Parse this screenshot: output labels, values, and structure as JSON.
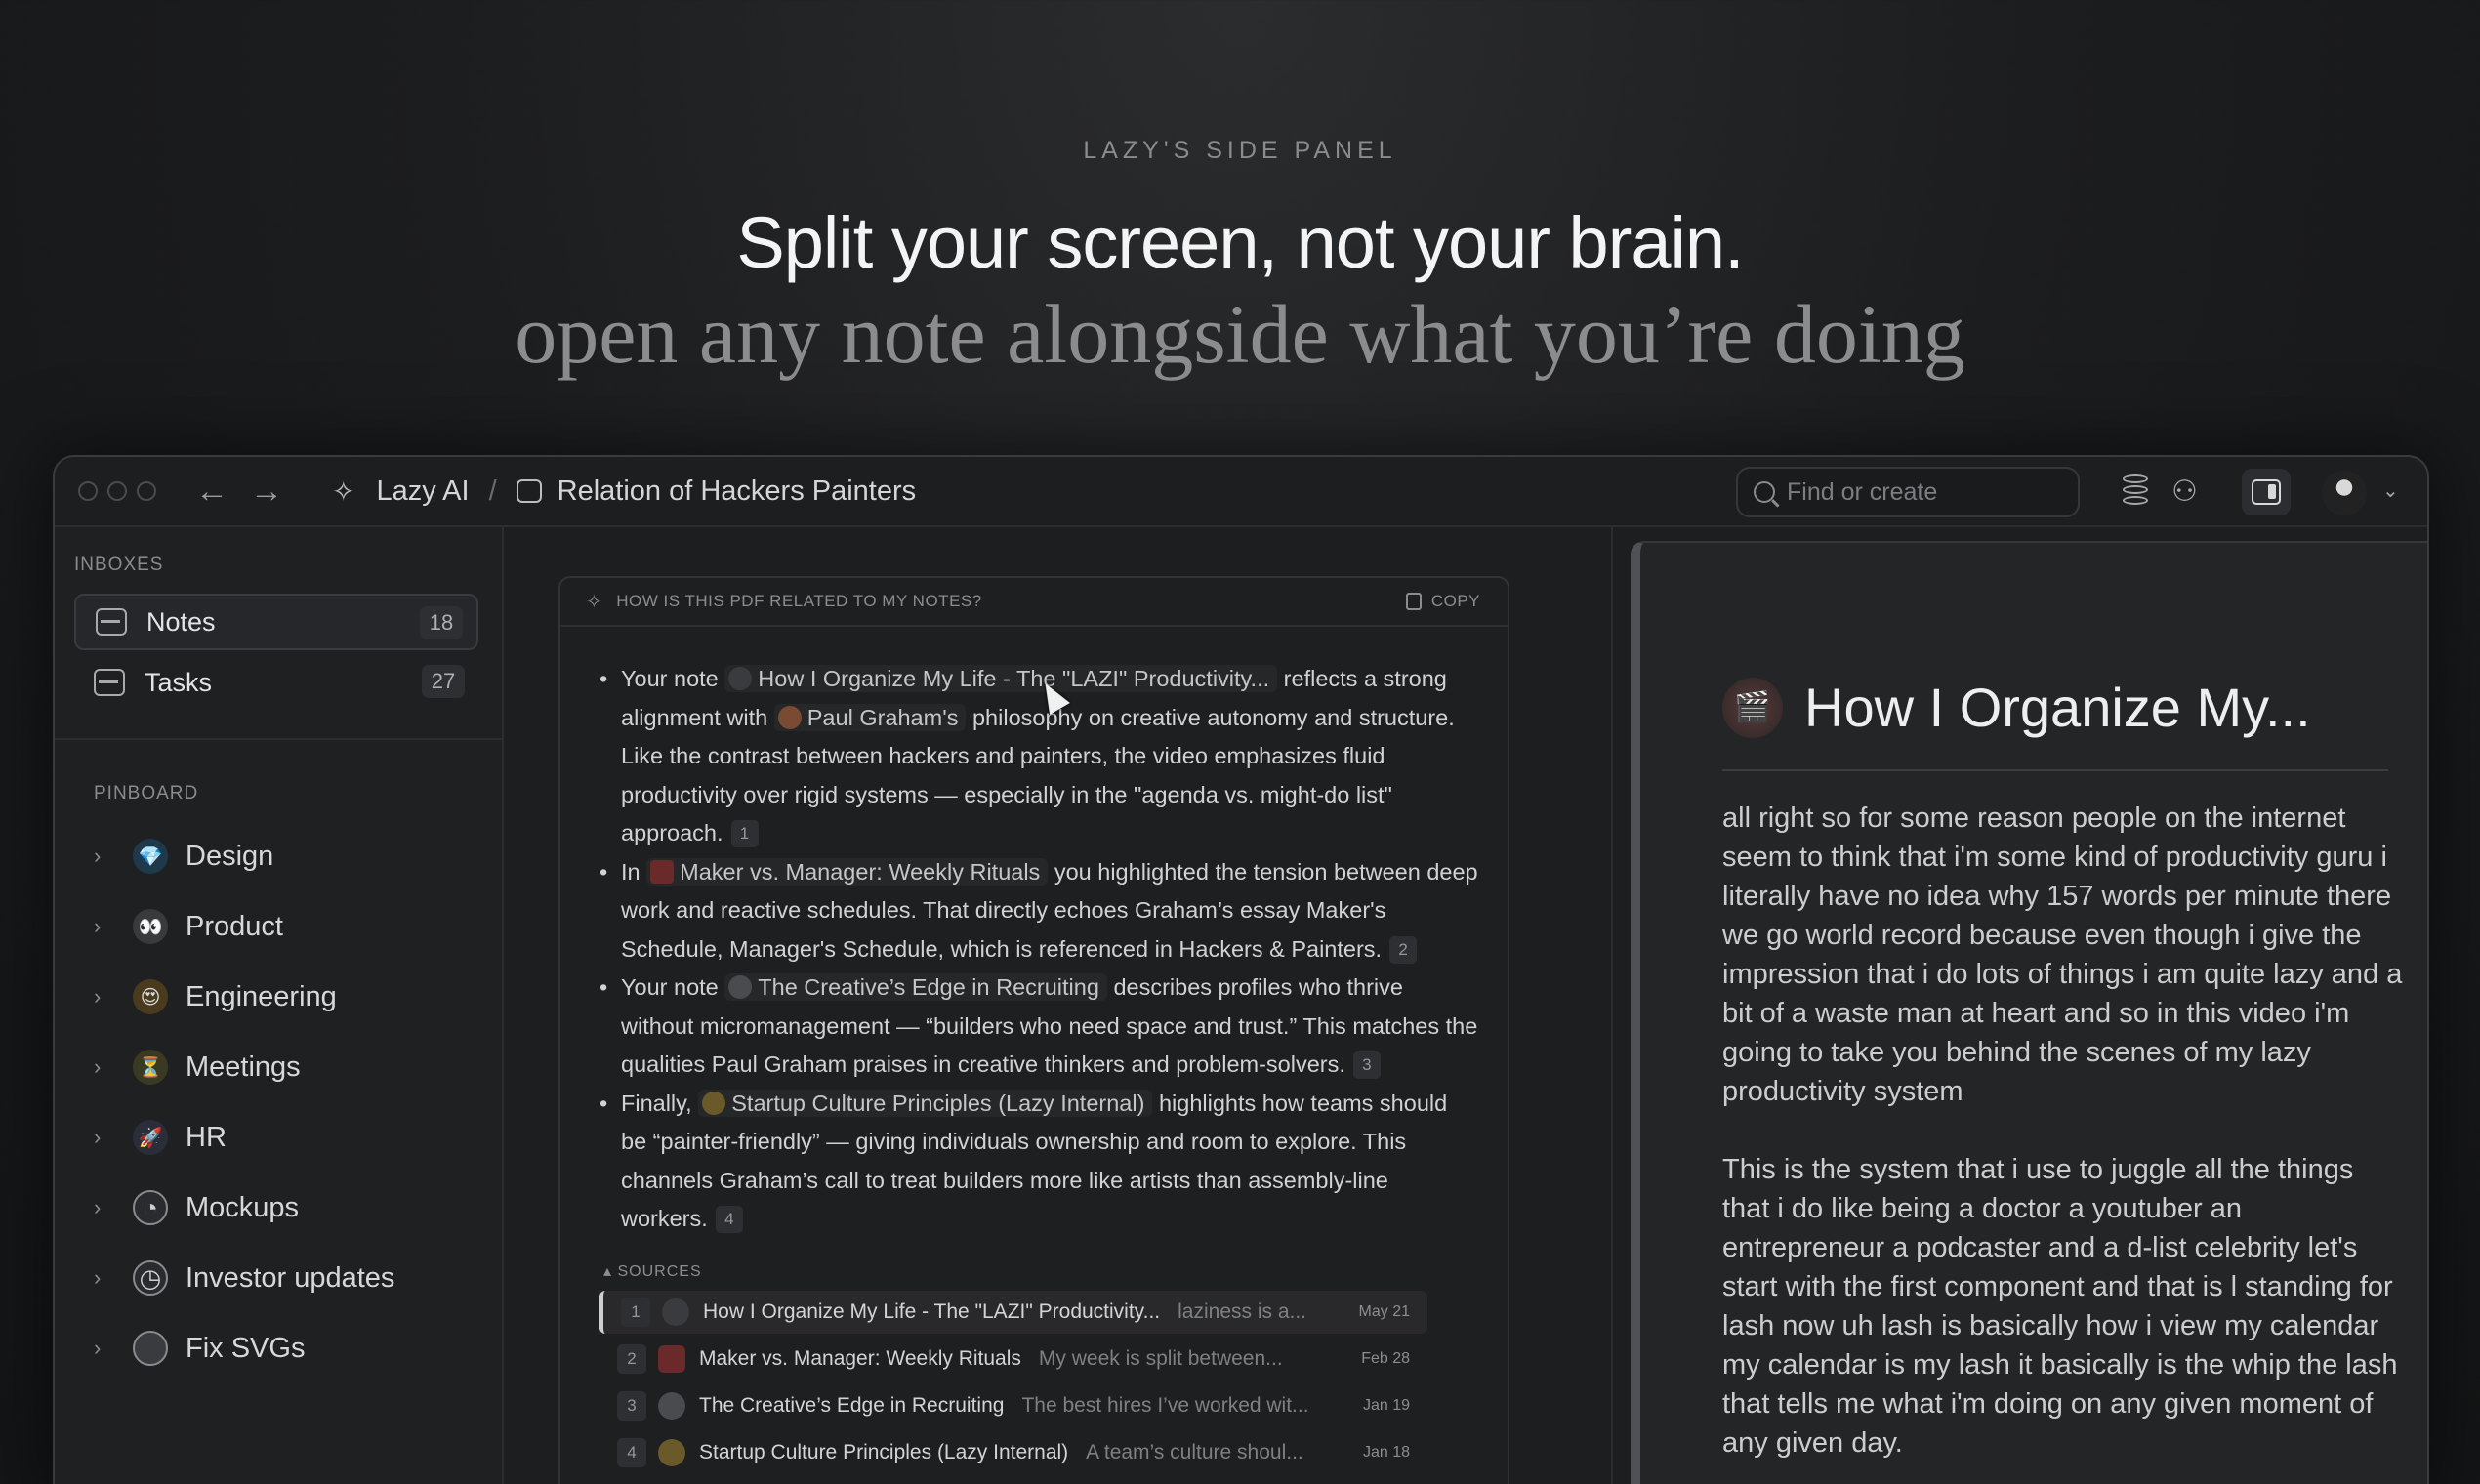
{
  "hero": {
    "eyebrow": "LAZY'S SIDE PANEL",
    "headline": "Split your screen, not your brain.",
    "subline": "open any note alongside what you’re doing"
  },
  "titlebar": {
    "breadcrumb_root": "Lazy AI",
    "breadcrumb_sep": "/",
    "breadcrumb_doc": "Relation of Hackers Painters",
    "search_placeholder": "Find or create"
  },
  "sidebar": {
    "inboxes_label": "INBOXES",
    "inboxes": [
      {
        "label": "Notes",
        "count": "18"
      },
      {
        "label": "Tasks",
        "count": "27"
      }
    ],
    "pinboard_label": "PINBOARD",
    "pinboard": [
      {
        "label": "Design",
        "icon": "diamond-icon",
        "glyph": "💎",
        "color": "#1e3a4a"
      },
      {
        "label": "Product",
        "icon": "eyes-icon",
        "glyph": "👀",
        "color": "#3a3a3a"
      },
      {
        "label": "Engineering",
        "icon": "smile-icon",
        "glyph": "😍",
        "color": "#4a3a1e"
      },
      {
        "label": "Meetings",
        "icon": "hourglass-icon",
        "glyph": "⏳",
        "color": "#3a3a22"
      },
      {
        "label": "HR",
        "icon": "rocket-icon",
        "glyph": "🚀",
        "color": "#2a2e3a"
      },
      {
        "label": "Mockups",
        "icon": "pie-icon",
        "glyph": "◔",
        "color": "#2a2b2e"
      },
      {
        "label": "Investor updates",
        "icon": "clock-icon",
        "glyph": "◷",
        "color": "#2a2b2e"
      },
      {
        "label": "Fix SVGs",
        "icon": "circle-icon",
        "glyph": "●",
        "color": "#3a3b3e"
      }
    ]
  },
  "ai": {
    "question": "HOW IS THIS PDF RELATED TO MY NOTES?",
    "copy_label": "COPY",
    "b1": {
      "pre": "Your note",
      "chip": "How I Organize My Life - The \"LAZI\" Productivity...",
      "mid": "reflects a strong alignment with",
      "chip2": "Paul Graham's",
      "post": "philosophy on creative autonomy and structure. Like the contrast between hackers and painters, the video emphasizes fluid productivity over rigid systems — especially in the \"agenda vs. might-do list\" approach.",
      "cite": "1"
    },
    "b2": {
      "pre": "In",
      "chip": "Maker vs. Manager: Weekly Rituals",
      "post": "you highlighted the tension between deep work and reactive schedules. That directly echoes Graham’s essay Maker's Schedule, Manager's Schedule, which is referenced in Hackers & Painters.",
      "cite": "2"
    },
    "b3": {
      "pre": "Your note",
      "chip": "The Creative’s Edge in Recruiting",
      "post": "describes profiles who thrive without micromanagement — “builders who need space and trust.” This matches the qualities Paul Graham praises in creative thinkers and problem-solvers.",
      "cite": "3"
    },
    "b4": {
      "pre": "Finally,",
      "chip": "Startup Culture Principles (Lazy Internal)",
      "post": "highlights how teams should be “painter-friendly” — giving individuals ownership and room to explore. This channels Graham’s call to treat builders more like artists than assembly-line workers.",
      "cite": "4"
    },
    "sources_label": "SOURCES",
    "sources": [
      {
        "num": "1",
        "title": "How I Organize My Life - The \"LAZI\" Productivity...",
        "snippet": "laziness is a...",
        "date": "May 21"
      },
      {
        "num": "2",
        "title": "Maker vs. Manager: Weekly Rituals",
        "snippet": "My week is split between...",
        "date": "Feb 28"
      },
      {
        "num": "3",
        "title": "The Creative’s Edge in Recruiting",
        "snippet": "The best hires I’ve worked wit...",
        "date": "Jan 19"
      },
      {
        "num": "4",
        "title": "Startup Culture Principles (Lazy Internal)",
        "snippet": "A team’s culture shoul...",
        "date": "Jan 18"
      }
    ]
  },
  "note": {
    "title": "How I Organize My...",
    "para1": "all right so for some reason people on the internet seem to think that i'm some kind of productivity guru i literally have no idea why 157 words per minute there we go world record because even though i give the impression that i do lots of things i am quite lazy and a bit of a waste man at heart and so in this video i'm going to take you behind the scenes of my lazy productivity system",
    "para2": "This is the system that i use to juggle all the things that i do like being a doctor a youtuber an entrepreneur a podcaster and a d-list celebrity let's start with the first  component and that is l standing for lash now uh lash is basically how i view my calendar my calendar is my lash it basically is the whip the lash that tells me what i'm doing on any given moment of any given day."
  }
}
